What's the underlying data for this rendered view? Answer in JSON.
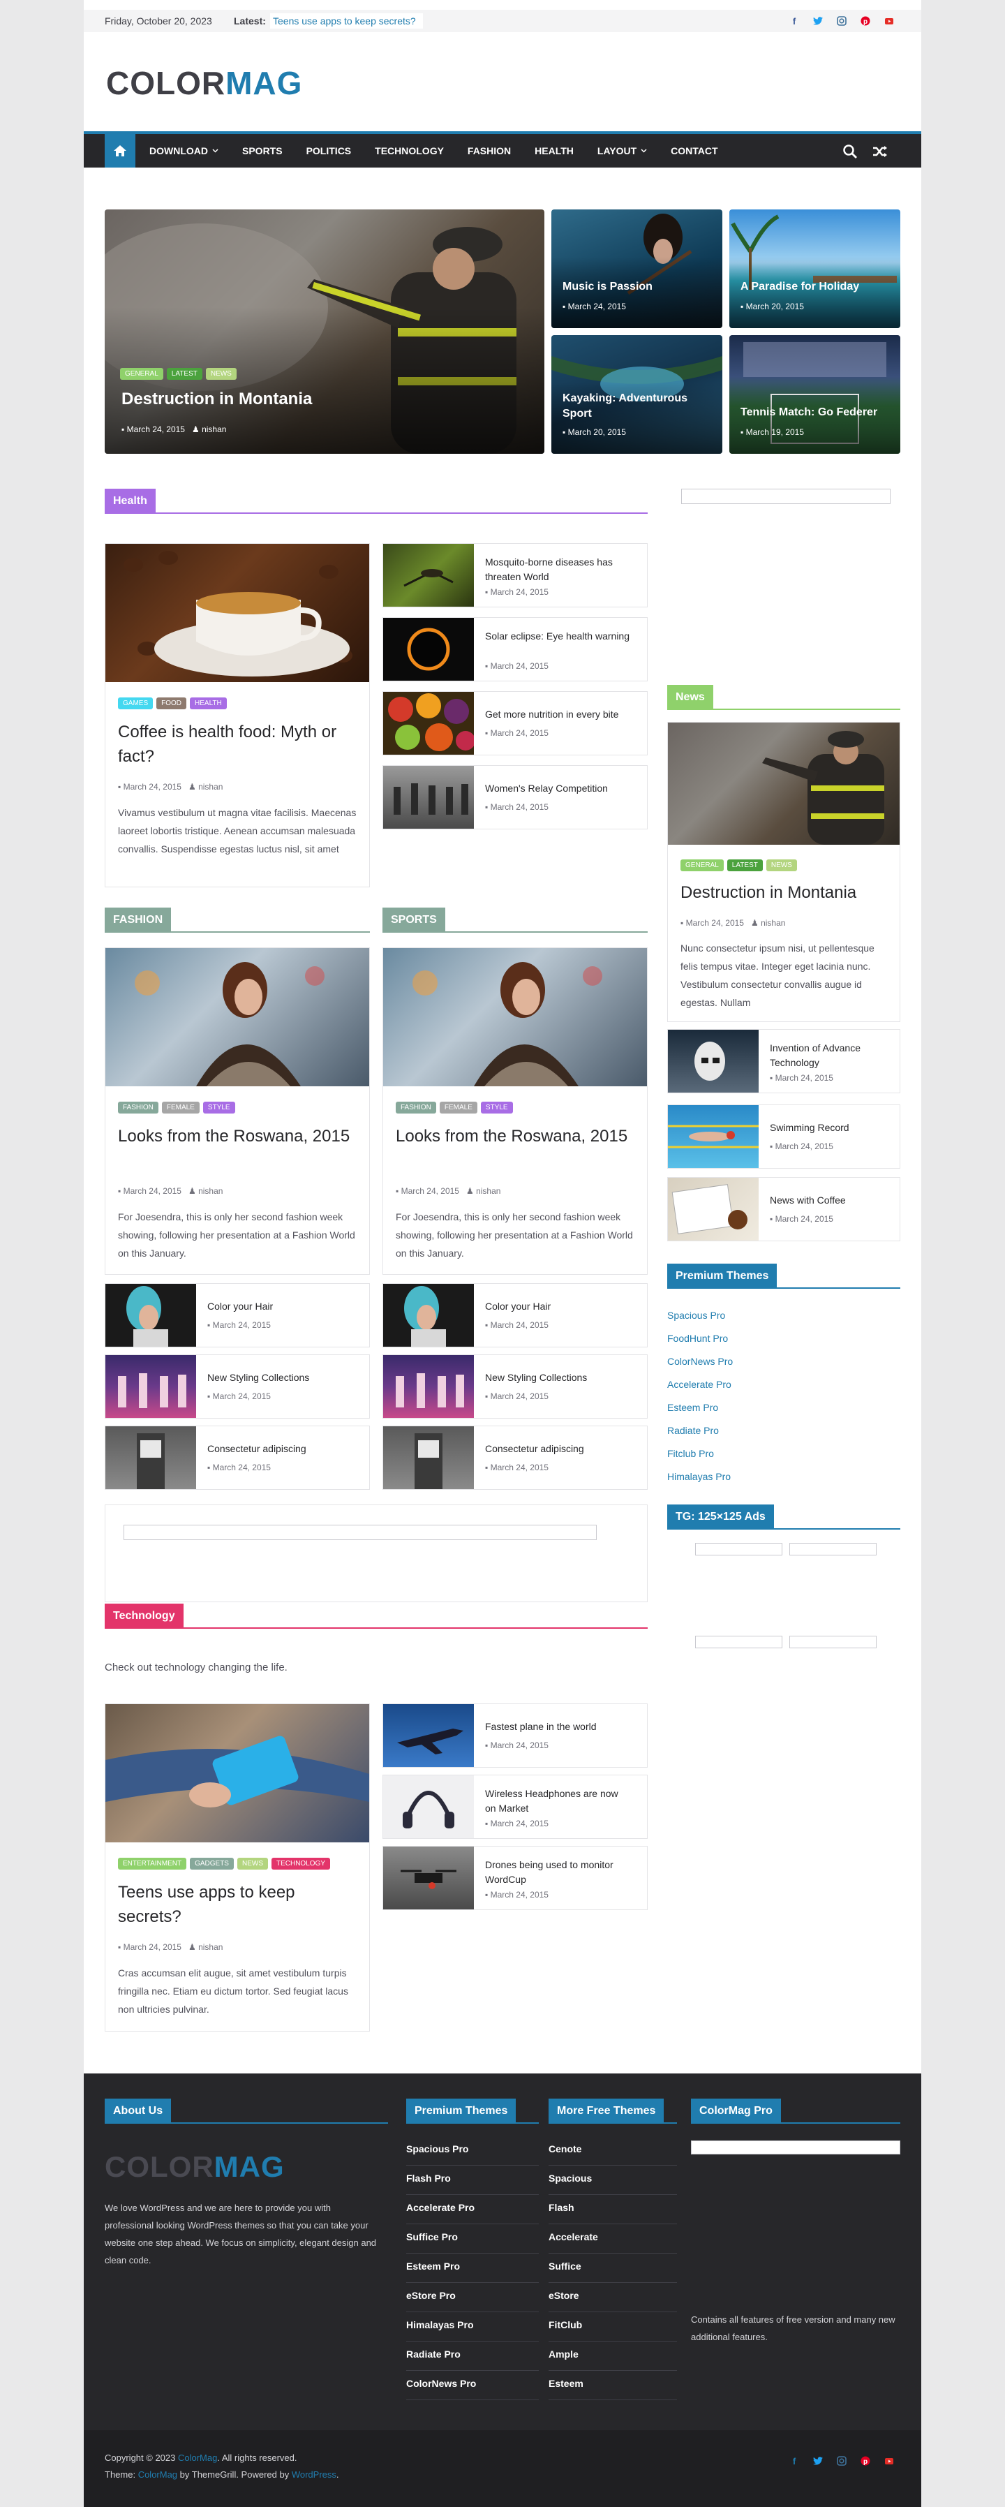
{
  "topbar": {
    "date": "Friday, October 20, 2023",
    "latest_label": "Latest:",
    "latest_link": "Teens use apps to keep secrets?"
  },
  "social_icons": [
    "facebook-icon",
    "twitter-icon",
    "instagram-icon",
    "pinterest-icon",
    "youtube-icon"
  ],
  "logo": {
    "part1": "COLOR",
    "part2": "MAG"
  },
  "nav": {
    "items": [
      "DOWNLOAD",
      "SPORTS",
      "POLITICS",
      "TECHNOLOGY",
      "FASHION",
      "HEALTH",
      "LAYOUT",
      "CONTACT"
    ]
  },
  "hero": {
    "main": {
      "title": "Destruction in Montania",
      "date": "March 24, 2015",
      "author": "nishan",
      "tags": [
        "GENERAL",
        "LATEST",
        "NEWS"
      ]
    },
    "tiles": [
      {
        "title": "Music is Passion",
        "date": "March 24, 2015"
      },
      {
        "title": "A Paradise for Holiday",
        "date": "March 20, 2015"
      },
      {
        "title": "Kayaking: Adventurous Sport",
        "date": "March 20, 2015"
      },
      {
        "title": "Tennis Match: Go Federer",
        "date": "March 19, 2015"
      }
    ]
  },
  "health": {
    "heading": "Health",
    "featured": {
      "tags": [
        "GAMES",
        "FOOD",
        "HEALTH"
      ],
      "title": "Coffee is health food: Myth or fact?",
      "date": "March 24, 2015",
      "author": "nishan",
      "excerpt": "Vivamus vestibulum ut magna vitae facilisis. Maecenas laoreet lobortis tristique. Aenean accumsan malesuada convallis. Suspendisse egestas luctus nisl, sit amet"
    },
    "list": [
      {
        "title": "Mosquito-borne diseases has threaten World",
        "date": "March 24, 2015"
      },
      {
        "title": "Solar eclipse: Eye health warning",
        "date": "March 24, 2015"
      },
      {
        "title": "Get more nutrition in every bite",
        "date": "March 24, 2015"
      },
      {
        "title": "Women's Relay Competition",
        "date": "March 24, 2015"
      }
    ]
  },
  "fashion": {
    "heading": "FASHION",
    "featured": {
      "tags": [
        "FASHION",
        "FEMALE",
        "STYLE"
      ],
      "title": "Looks from the Roswana, 2015",
      "date": "March 24, 2015",
      "author": "nishan",
      "excerpt": "For Joesendra, this is only her second fashion week showing, following her presentation at a Fashion World on this January."
    },
    "list": [
      {
        "title": "Color your Hair",
        "date": "March 24, 2015"
      },
      {
        "title": "New Styling Collections",
        "date": "March 24, 2015"
      },
      {
        "title": "Consectetur adipiscing",
        "date": "March 24, 2015"
      }
    ]
  },
  "sports": {
    "heading": "SPORTS",
    "featured": {
      "tags": [
        "FASHION",
        "FEMALE",
        "STYLE"
      ],
      "title": "Looks from the Roswana, 2015",
      "date": "March 24, 2015",
      "author": "nishan",
      "excerpt": "For Joesendra, this is only her second fashion week showing, following her presentation at a Fashion World on this January."
    },
    "list": [
      {
        "title": "Color your Hair",
        "date": "March 24, 2015"
      },
      {
        "title": "New Styling Collections",
        "date": "March 24, 2015"
      },
      {
        "title": "Consectetur adipiscing",
        "date": "March 24, 2015"
      }
    ]
  },
  "technology": {
    "heading": "Technology",
    "description": "Check out technology changing the life.",
    "featured": {
      "tags": [
        "ENTERTAINMENT",
        "GADGETS",
        "NEWS",
        "TECHNOLOGY"
      ],
      "title": "Teens use apps to keep secrets?",
      "date": "March 24, 2015",
      "author": "nishan",
      "excerpt": "Cras accumsan elit augue, sit amet vestibulum turpis fringilla nec. Etiam eu dictum tortor. Sed feugiat lacus non ultricies pulvinar."
    },
    "list": [
      {
        "title": "Fastest plane in the world",
        "date": "March 24, 2015"
      },
      {
        "title": "Wireless Headphones are now on Market",
        "date": "March 24, 2015"
      },
      {
        "title": "Drones being used to monitor WordCup",
        "date": "March 24, 2015"
      }
    ]
  },
  "sidebar": {
    "news": {
      "heading": "News",
      "tags": [
        "GENERAL",
        "LATEST",
        "NEWS"
      ],
      "title": "Destruction in Montania",
      "date": "March 24, 2015",
      "author": "nishan",
      "excerpt": "Nunc consectetur ipsum nisi, ut pellentesque felis tempus vitae. Integer eget lacinia nunc. Vestibulum consectetur convallis augue id egestas. Nullam",
      "list": [
        {
          "title": "Invention of Advance Technology",
          "date": "March 24, 2015"
        },
        {
          "title": "Swimming Record",
          "date": "March 24, 2015"
        },
        {
          "title": "News with Coffee",
          "date": "March 24, 2015"
        }
      ]
    },
    "premium": {
      "heading": "Premium Themes",
      "links": [
        "Spacious Pro",
        "FoodHunt Pro",
        "ColorNews Pro",
        "Accelerate Pro",
        "Esteem Pro",
        "Radiate Pro",
        "Fitclub Pro",
        "Himalayas Pro"
      ]
    },
    "ads": {
      "heading": "TG: 125×125 Ads"
    }
  },
  "footer": {
    "about": {
      "heading": "About Us",
      "text": "We love WordPress and we are here to provide you with professional looking WordPress themes so that you can take your website one step ahead. We focus on simplicity, elegant design and clean code."
    },
    "premium": {
      "heading": "Premium Themes",
      "items": [
        "Spacious Pro",
        "Flash Pro",
        "Accelerate Pro",
        "Suffice Pro",
        "Esteem Pro",
        "eStore Pro",
        "Himalayas Pro",
        "Radiate Pro",
        "ColorNews Pro"
      ]
    },
    "free": {
      "heading": "More Free Themes",
      "items": [
        "Cenote",
        "Spacious",
        "Flash",
        "Accelerate",
        "Suffice",
        "eStore",
        "FitClub",
        "Ample",
        "Esteem"
      ]
    },
    "colormag": {
      "heading": "ColorMag Pro",
      "text": "Contains all features of free version and many new additional features."
    },
    "copyright": {
      "prefix": "Copyright © 2023 ",
      "site": "ColorMag",
      "suffix": ". All rights reserved.",
      "theme_prefix": "Theme: ",
      "theme": "ColorMag",
      "by": " by ThemeGrill. Powered by ",
      "wp": "WordPress",
      "end": "."
    }
  },
  "colors": {
    "accent": "#207daf",
    "health": "#a86de5",
    "fashion": "#86a89a",
    "technology": "#e3346a",
    "news": "#8fd16b"
  }
}
